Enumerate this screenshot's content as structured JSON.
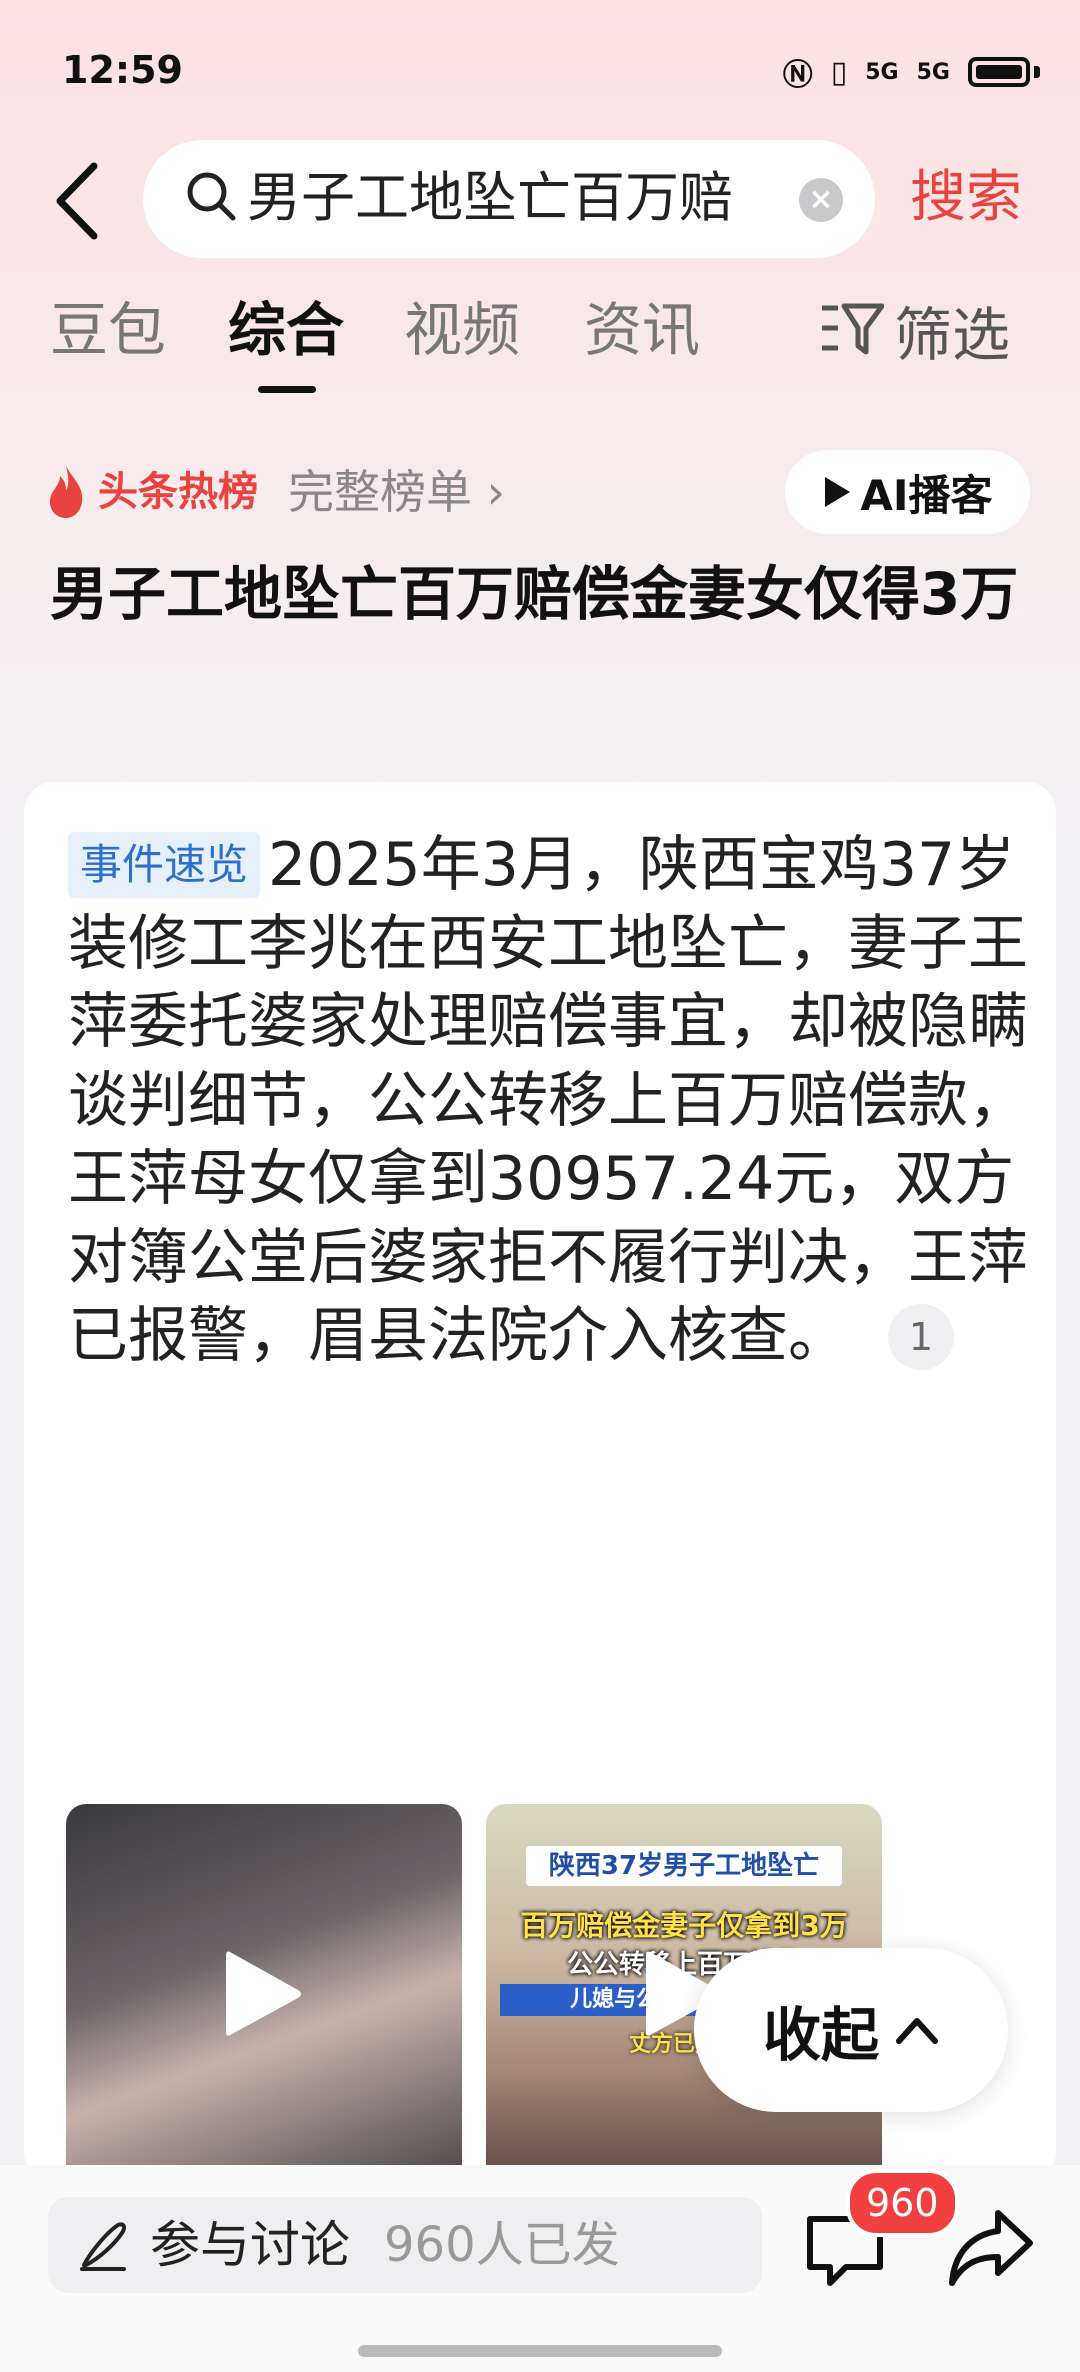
{
  "status_bar": {
    "time": "12:59",
    "signal_1": "5G",
    "signal_2": "5G"
  },
  "search": {
    "query": "男子工地坠亡百万赔",
    "submit_label": "搜索"
  },
  "tabs": [
    {
      "label": "豆包"
    },
    {
      "label": "综合"
    },
    {
      "label": "视频"
    },
    {
      "label": "资讯"
    }
  ],
  "filter_label": "筛选",
  "hot": {
    "label": "头条热榜",
    "full_list": "完整榜单 ›",
    "ai_button": "AI播客"
  },
  "headline": "男子工地坠亡百万赔偿金妻女仅得3万",
  "summary": {
    "tag": "事件速览",
    "text": "2025年3月，陕西宝鸡37岁装修工李兆在西安工地坠亡，妻子王萍委托婆家处理赔偿事宜，却被隐瞒谈判细节，公公转移上百万赔偿款，王萍母女仅拿到30957.24元，双方对簿公堂后婆家拒不履行判决，王萍已报警，眉县法院介入核查。",
    "ref": "1"
  },
  "thumb2_captions": {
    "line1": "陕西37岁男子工地坠亡",
    "line2": "百万赔偿金妻子仅拿到3万",
    "line3": "公公转移上百万钱款",
    "line4": "儿媳与公婆对簿公堂 男",
    "line5": "丈方已报警"
  },
  "collapse_label": "收起",
  "bottom": {
    "discuss_label": "参与讨论",
    "discuss_count": "960人已发",
    "comment_badge": "960"
  },
  "colors": {
    "accent": "#e8433e",
    "tag_blue": "#2f6fcc",
    "badge_red": "#f04140"
  }
}
